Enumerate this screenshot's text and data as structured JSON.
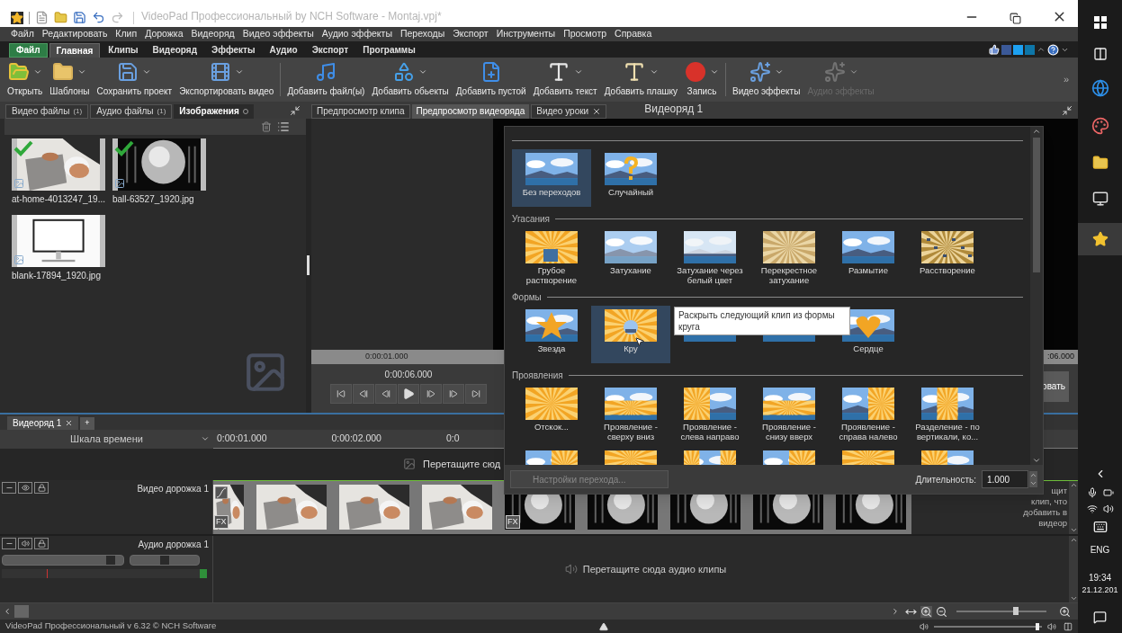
{
  "title_bar": {
    "title": "VideoPad Профессиональный by NCH Software - Montaj.vpj*"
  },
  "menu": [
    "Файл",
    "Редактировать",
    "Клип",
    "Дорожка",
    "Видеоряд",
    "Видео эффекты",
    "Аудио эффекты",
    "Переходы",
    "Экспорт",
    "Инструменты",
    "Просмотр",
    "Справка"
  ],
  "ribbon_tabs": [
    {
      "label": "Файл",
      "kind": "file",
      "selected": false
    },
    {
      "label": "Главная",
      "kind": "tab",
      "selected": true
    },
    {
      "label": "Клипы",
      "kind": "tab",
      "selected": false
    },
    {
      "label": "Видеоряд",
      "kind": "tab",
      "selected": false
    },
    {
      "label": "Эффекты",
      "kind": "tab",
      "selected": false
    },
    {
      "label": "Аудио",
      "kind": "tab",
      "selected": false
    },
    {
      "label": "Экспорт",
      "kind": "tab",
      "selected": false
    },
    {
      "label": "Программы",
      "kind": "tab",
      "selected": false
    }
  ],
  "toolbar": [
    {
      "label": "Открыть",
      "dropdown": true,
      "disabled": false
    },
    {
      "label": "Шаблоны",
      "dropdown": true,
      "disabled": false
    },
    {
      "label": "Сохранить проект",
      "dropdown": true,
      "disabled": false
    },
    {
      "label": "Экспортировать видео",
      "dropdown": true,
      "disabled": false
    },
    {
      "label": "Добавить файл(ы)",
      "dropdown": false,
      "disabled": false
    },
    {
      "label": "Добавить обьекты",
      "dropdown": true,
      "disabled": false
    },
    {
      "label": "Добавить пустой",
      "dropdown": false,
      "disabled": false
    },
    {
      "label": "Добавить текст",
      "dropdown": true,
      "disabled": false
    },
    {
      "label": "Добавить плашку",
      "dropdown": true,
      "disabled": false
    },
    {
      "label": "Запись",
      "dropdown": true,
      "disabled": false
    },
    {
      "label": "Видео эффекты",
      "dropdown": true,
      "disabled": false
    },
    {
      "label": "Аудио эффекты",
      "dropdown": true,
      "disabled": true
    }
  ],
  "toolbar_more": "»",
  "media_panel": {
    "tabs": [
      {
        "label": "Видео файлы",
        "count": "(1)",
        "selected": false
      },
      {
        "label": "Аудио файлы",
        "count": "(1)",
        "selected": false
      },
      {
        "label": "Изображения",
        "selected": true
      }
    ],
    "files": [
      {
        "name": "at-home-4013247_19...",
        "kind": "desk",
        "checked": true
      },
      {
        "name": "ball-63527_1920.jpg",
        "kind": "ball",
        "checked": true
      },
      {
        "name": "blank-17894_1920.jpg",
        "kind": "monitor",
        "checked": false
      }
    ]
  },
  "preview": {
    "tabs": [
      {
        "label": "Предпросмотр клипа",
        "selected": false,
        "closable": false
      },
      {
        "label": "Предпросмотр видеоряда",
        "selected": true,
        "closable": false
      },
      {
        "label": "Видео уроки",
        "selected": false,
        "closable": true
      }
    ],
    "title": "Видеоряд 1",
    "ruler_time": "0:00:01.000",
    "ruler_end": ":06.000",
    "time": "0:00:06.000",
    "side_button": "овать"
  },
  "transitions": {
    "groups": [
      {
        "items": [
          {
            "label": "Без переходов",
            "kind": "landscape",
            "selected": true
          },
          {
            "label": "Случайный",
            "kind": "random",
            "selected": false
          }
        ]
      },
      {
        "title": "Угасания",
        "items": [
          {
            "label": "Грубое растворение",
            "kind": "burst",
            "selected": false
          },
          {
            "label": "Затухание",
            "kind": "fade",
            "selected": false
          },
          {
            "label": "Затухание через белый цвет",
            "kind": "white",
            "selected": false
          },
          {
            "label": "Перекрестное затухание",
            "kind": "sepia",
            "selected": false
          },
          {
            "label": "Размытие",
            "kind": "landscape",
            "selected": false
          },
          {
            "label": "Расстворение",
            "kind": "dissolve",
            "selected": false
          }
        ]
      },
      {
        "title": "Формы",
        "items": [
          {
            "label": "Звезда",
            "kind": "star",
            "selected": false
          },
          {
            "label": "Кру",
            "kind": "circle",
            "selected": true
          },
          {
            "kind": "rays-top",
            "selected": false
          },
          {
            "kind": "sun",
            "selected": false
          },
          {
            "label": "Сердце",
            "kind": "heart",
            "selected": false
          }
        ]
      },
      {
        "title": "Проявления",
        "items": [
          {
            "label": "Отскок...",
            "kind": "rays",
            "selected": false
          },
          {
            "label": "Проявление - сверху вниз",
            "kind": "rays-bottom",
            "selected": false
          },
          {
            "label": "Проявление - слева направо",
            "kind": "rays-left",
            "selected": false
          },
          {
            "label": "Проявление - снизу вверх",
            "kind": "rays-bottom",
            "selected": false
          },
          {
            "label": "Проявление - справа налево",
            "kind": "rays-right",
            "selected": false
          },
          {
            "label": "Разделение - по вертикали, ко...",
            "kind": "rays-middle",
            "selected": false
          },
          {
            "kind": "rays-right",
            "selected": false
          },
          {
            "kind": "rays-top",
            "selected": false
          },
          {
            "kind": "rays-sides",
            "selected": false
          },
          {
            "kind": "rays-right",
            "selected": false
          },
          {
            "kind": "rays-top",
            "selected": false
          },
          {
            "kind": "rays-left",
            "selected": false
          }
        ]
      }
    ],
    "tooltip": "Раскрыть следующий клип из формы круга",
    "settings_button": "Настройки перехода...",
    "duration_label": "Длительность:",
    "duration_value": "1.000"
  },
  "timeline": {
    "tabs": [
      {
        "label": "Видеоряд 1",
        "selected": true,
        "closable": true
      }
    ],
    "add_tab": "+",
    "ruler_label": "Шкала времени",
    "ticks": [
      "0:00:01.000",
      "0:00:02.000",
      "0:0"
    ],
    "drop_hint": "Перетащите сюд",
    "video_track": {
      "name": "Видео дорожка 1",
      "clips": [
        {
          "kind": "desk",
          "badge": "FX"
        },
        {
          "kind": "desk"
        },
        {
          "kind": "desk"
        },
        {
          "kind": "desk"
        },
        {
          "kind": "ball",
          "badge": "FX"
        },
        {
          "kind": "ball"
        },
        {
          "kind": "ball"
        },
        {
          "kind": "ball"
        },
        {
          "kind": "ball"
        }
      ],
      "side_hint": [
        "щит",
        "клип, что",
        "добавить в",
        "видеор"
      ]
    },
    "audio_track": {
      "name": "Аудио дорожка 1",
      "volume": {
        "level": 0.93
      },
      "pan": {
        "level": 0.5
      },
      "hint": "Перетащите сюда аудио клипы"
    },
    "zoom": {
      "level": 0.66
    }
  },
  "status_bar": {
    "text": "VideoPad Профессиональный v 6.32 © NCH Software",
    "volume": {
      "level": 0.96
    }
  },
  "taskbar": {
    "language": "ENG",
    "time": "19:34",
    "date": "21.12.201"
  }
}
